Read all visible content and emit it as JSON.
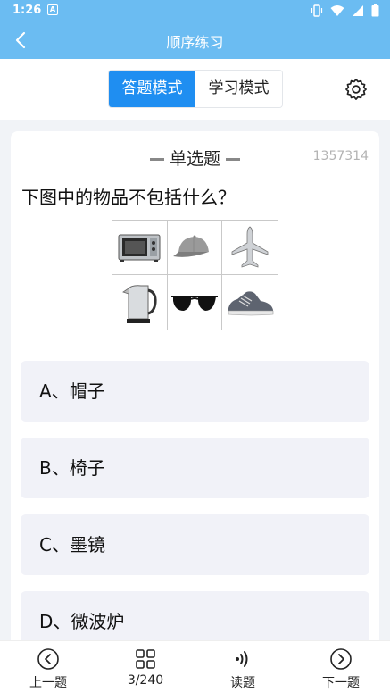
{
  "status": {
    "time": "1:26",
    "sim_label": "A"
  },
  "header": {
    "title": "顺序练习"
  },
  "modes": {
    "answer": "答题模式",
    "study": "学习模式"
  },
  "question": {
    "type": "单选题",
    "id": "1357314",
    "text": "下图中的物品不包括什么？",
    "images": [
      "microwave-oven",
      "baseball-cap",
      "airplane",
      "electric-kettle",
      "sunglasses",
      "sneaker"
    ]
  },
  "options": [
    {
      "label": "A、帽子"
    },
    {
      "label": "B、椅子"
    },
    {
      "label": "C、墨镜"
    },
    {
      "label": "D、微波炉"
    }
  ],
  "bottom_nav": {
    "prev": "上一题",
    "progress": "3/240",
    "read": "读题",
    "next": "下一题"
  }
}
